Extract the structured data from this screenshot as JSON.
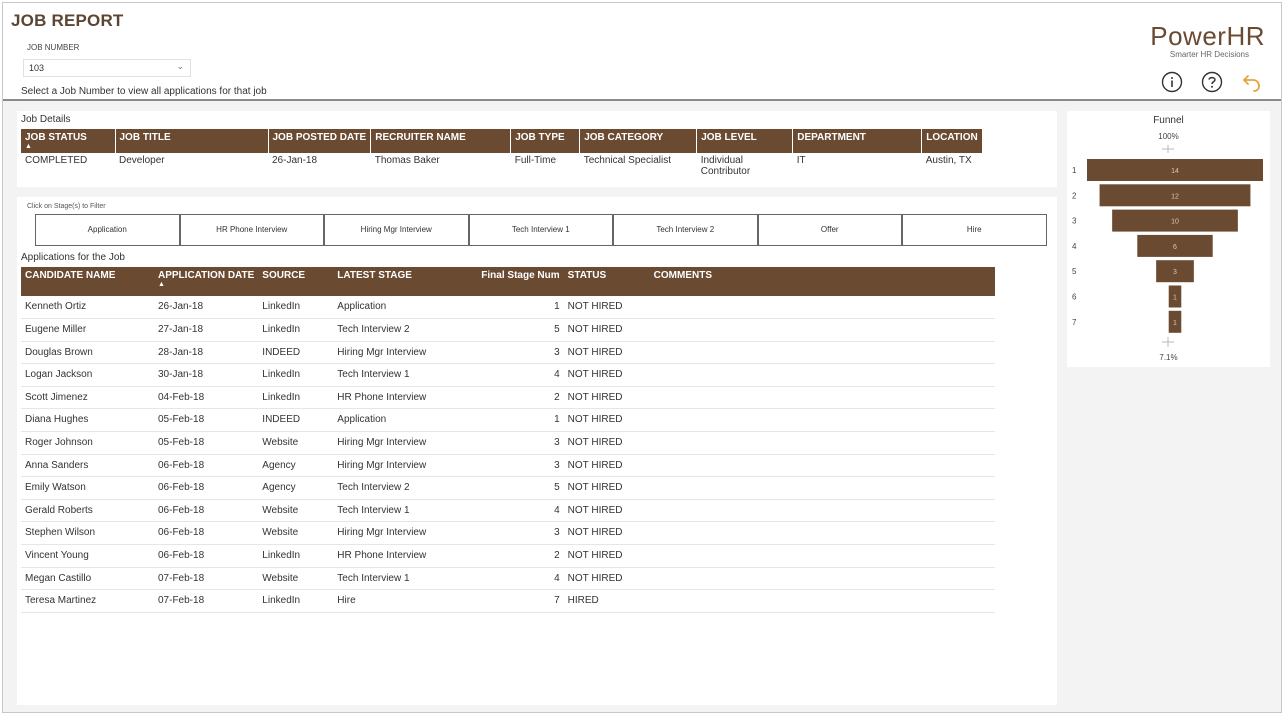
{
  "header": {
    "title": "JOB REPORT",
    "job_number_label": "JOB NUMBER",
    "job_number_value": "103",
    "hint": "Select a Job Number to view all applications for that job",
    "brand_name": "PowerHR",
    "brand_tagline": "Smarter HR Decisions"
  },
  "job_details": {
    "section_title": "Job Details",
    "columns": [
      "JOB STATUS",
      "JOB TITLE",
      "JOB POSTED DATE",
      "RECRUITER NAME",
      "JOB TYPE",
      "JOB CATEGORY",
      "JOB LEVEL",
      "DEPARTMENT",
      "LOCATION"
    ],
    "row": [
      "COMPLETED",
      "Developer",
      "26-Jan-18",
      "Thomas Baker",
      "Full-Time",
      "Technical Specialist",
      "Individual Contributor",
      "IT",
      "Austin, TX"
    ]
  },
  "stages": {
    "hint": "Click on Stage(s) to Filter",
    "buttons": [
      "Application",
      "HR Phone Interview",
      "Hiring Mgr Interview",
      "Tech Interview 1",
      "Tech Interview 2",
      "Offer",
      "Hire"
    ]
  },
  "applications": {
    "section_title": "Applications for the Job",
    "columns": [
      "CANDIDATE NAME",
      "APPLICATION DATE",
      "SOURCE",
      "LATEST STAGE",
      "Final Stage Num",
      "STATUS",
      "COMMENTS"
    ],
    "rows": [
      [
        "Kenneth Ortiz",
        "26-Jan-18",
        "LinkedIn",
        "Application",
        "1",
        "NOT HIRED",
        ""
      ],
      [
        "Eugene Miller",
        "27-Jan-18",
        "LinkedIn",
        "Tech Interview 2",
        "5",
        "NOT HIRED",
        ""
      ],
      [
        "Douglas Brown",
        "28-Jan-18",
        "INDEED",
        "Hiring Mgr Interview",
        "3",
        "NOT HIRED",
        ""
      ],
      [
        "Logan Jackson",
        "30-Jan-18",
        "LinkedIn",
        "Tech Interview 1",
        "4",
        "NOT HIRED",
        ""
      ],
      [
        "Scott Jimenez",
        "04-Feb-18",
        "LinkedIn",
        "HR Phone Interview",
        "2",
        "NOT HIRED",
        ""
      ],
      [
        "Diana Hughes",
        "05-Feb-18",
        "INDEED",
        "Application",
        "1",
        "NOT HIRED",
        ""
      ],
      [
        "Roger Johnson",
        "05-Feb-18",
        "Website",
        "Hiring Mgr Interview",
        "3",
        "NOT HIRED",
        ""
      ],
      [
        "Anna Sanders",
        "06-Feb-18",
        "Agency",
        "Hiring Mgr Interview",
        "3",
        "NOT HIRED",
        ""
      ],
      [
        "Emily Watson",
        "06-Feb-18",
        "Agency",
        "Tech Interview 2",
        "5",
        "NOT HIRED",
        ""
      ],
      [
        "Gerald Roberts",
        "06-Feb-18",
        "Website",
        "Tech Interview 1",
        "4",
        "NOT HIRED",
        ""
      ],
      [
        "Stephen Wilson",
        "06-Feb-18",
        "Website",
        "Hiring Mgr Interview",
        "3",
        "NOT HIRED",
        ""
      ],
      [
        "Vincent Young",
        "06-Feb-18",
        "LinkedIn",
        "HR Phone Interview",
        "2",
        "NOT HIRED",
        ""
      ],
      [
        "Megan Castillo",
        "07-Feb-18",
        "Website",
        "Tech Interview 1",
        "4",
        "NOT HIRED",
        ""
      ],
      [
        "Teresa Martinez",
        "07-Feb-18",
        "LinkedIn",
        "Hire",
        "7",
        "HIRED",
        ""
      ]
    ]
  },
  "icons": {
    "info": "info-icon",
    "help": "help-icon",
    "back": "back-arrow-icon",
    "dropdown": "chevron-down-icon",
    "sort": "sort-ascending-icon"
  },
  "colors": {
    "accent": "#6b4a32",
    "back_icon": "#e8a33a"
  },
  "chart_data": {
    "type": "bar",
    "orientation": "funnel",
    "title": "Funnel",
    "categories": [
      "1",
      "2",
      "3",
      "4",
      "5",
      "6",
      "7"
    ],
    "values": [
      14,
      12,
      10,
      6,
      3,
      1,
      1
    ],
    "top_percent": "100%",
    "bottom_percent": "7.1%"
  }
}
